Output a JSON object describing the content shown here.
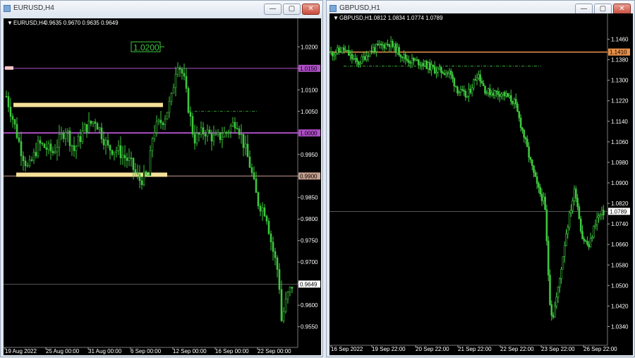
{
  "windows": {
    "left": {
      "title": "EURUSD,H4",
      "info": {
        "symbol": "EURUSD,H4",
        "ohlc": "0.9635 0.9670 0.9635 0.9649"
      },
      "price_label": "1.0200",
      "levels": {
        "l1": "1.0150",
        "l2": "1.0000",
        "l3": "0.9900",
        "current": "0.9649"
      }
    },
    "right": {
      "title": "GBPUSD,H1",
      "info": {
        "symbol": "GBPUSD,H1",
        "ohlc": "1.0812 1.0834 1.0774 1.0789"
      },
      "levels": {
        "l1": "1.1410",
        "current": "1.0789"
      }
    }
  },
  "buttons": {
    "minimize": "—",
    "restore": "▢",
    "close": "✕"
  },
  "colors": {
    "bull": "#3ec73e",
    "level_purple": "#b04fc8",
    "level_orange": "#e8914a",
    "zone": "#f6e09a",
    "bg": "#000000"
  },
  "chart_data": [
    {
      "type": "candlestick",
      "symbol": "EURUSD,H4",
      "y_ticks": [
        "1.0200",
        "1.0150",
        "1.0100",
        "1.0050",
        "1.0000",
        "0.9950",
        "0.9900",
        "0.9850",
        "0.9800",
        "0.9750",
        "0.9700",
        "0.9650",
        "0.9600",
        "0.9550"
      ],
      "x_ticks": [
        "19 Aug 2022",
        "25 Aug 00:00",
        "31 Aug 00:00",
        "6 Sep 00:00",
        "12 Sep 00:00",
        "16 Sep 00:00",
        "22 Sep 00:00"
      ],
      "ylim": [
        0.952,
        1.023
      ],
      "levels": [
        1.015,
        1.0,
        0.99
      ],
      "last": 0.9649
    },
    {
      "type": "candlestick",
      "symbol": "GBPUSD,H1",
      "y_ticks": [
        "1.1460",
        "1.1380",
        "1.1300",
        "1.1220",
        "1.1140",
        "1.1060",
        "1.0980",
        "1.0900",
        "1.0820",
        "1.0740",
        "1.0660",
        "1.0580",
        "1.0500",
        "1.0420",
        "1.0340"
      ],
      "x_ticks": [
        "16 Sep 2022",
        "19 Sep 22:00",
        "20 Sep 22:00",
        "21 Sep 22:00",
        "22 Sep 22:00",
        "23 Sep 22:00",
        "26 Sep 22:00"
      ],
      "ylim": [
        1.03,
        1.15
      ],
      "levels": [
        1.141
      ],
      "last": 1.0789
    }
  ]
}
